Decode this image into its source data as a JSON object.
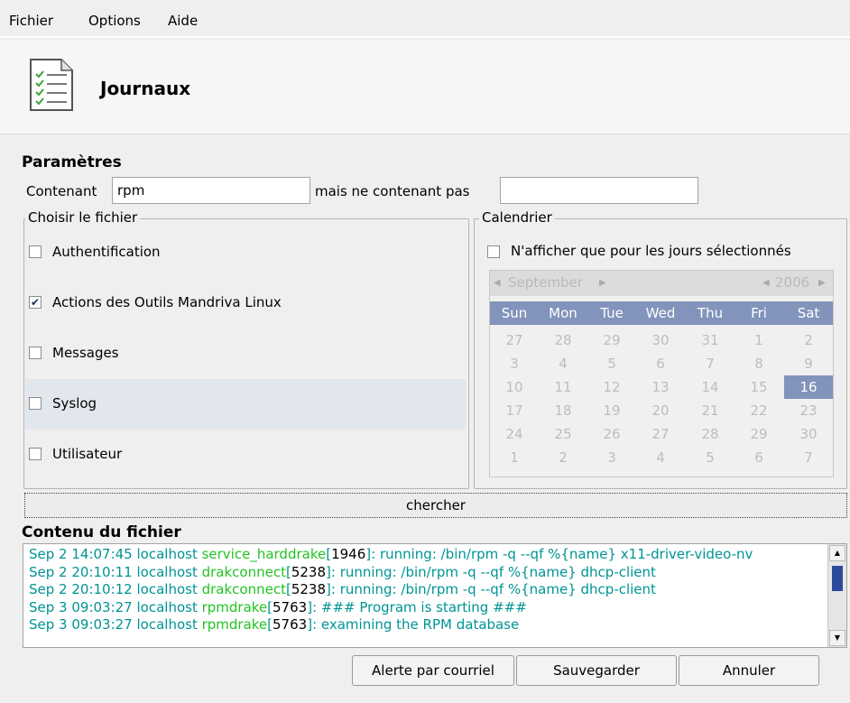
{
  "menu": [
    {
      "label": "Fichier"
    },
    {
      "label": "Options"
    },
    {
      "label": "Aide"
    }
  ],
  "banner": {
    "title": "Journaux",
    "icon": "document-checklist-icon"
  },
  "params": {
    "title": "Paramètres",
    "containing_label": "Contenant",
    "containing_value": "rpm",
    "not_containing_label": "mais ne contenant pas",
    "not_containing_value": ""
  },
  "files": {
    "title": "Choisir le fichier",
    "items": [
      {
        "label": "Authentification",
        "checked": false
      },
      {
        "label": "Actions des Outils Mandriva Linux",
        "checked": true
      },
      {
        "label": "Messages",
        "checked": false
      },
      {
        "label": "Syslog",
        "checked": false
      },
      {
        "label": "Utilisateur",
        "checked": false
      }
    ]
  },
  "calendar": {
    "title": "Calendrier",
    "only_selected_days_label": "N'afficher que pour les jours sélectionnés",
    "month": "September",
    "year": "2006",
    "weekdays": [
      "Sun",
      "Mon",
      "Tue",
      "Wed",
      "Thu",
      "Fri",
      "Sat"
    ],
    "weeks": [
      [
        "27",
        "28",
        "29",
        "30",
        "31",
        "1",
        "2"
      ],
      [
        "3",
        "4",
        "5",
        "6",
        "7",
        "8",
        "9"
      ],
      [
        "10",
        "11",
        "12",
        "13",
        "14",
        "15",
        "16"
      ],
      [
        "17",
        "18",
        "19",
        "20",
        "21",
        "22",
        "23"
      ],
      [
        "24",
        "25",
        "26",
        "27",
        "28",
        "29",
        "30"
      ],
      [
        "1",
        "2",
        "3",
        "4",
        "5",
        "6",
        "7"
      ]
    ],
    "selected_day": "16"
  },
  "search_button": "chercher",
  "content": {
    "title": "Contenu du fichier",
    "lines": [
      {
        "date": "Sep  2 14:07:45 localhost ",
        "prog": "service_harddrake",
        "pid": "1946",
        "msg": ": running: /bin/rpm -q --qf %{name} x11-driver-video-nv"
      },
      {
        "date": "Sep  2 20:10:11 localhost ",
        "prog": "drakconnect",
        "pid": "5238",
        "msg": ": running: /bin/rpm -q --qf %{name} dhcp-client"
      },
      {
        "date": "Sep  2 20:10:12 localhost ",
        "prog": "drakconnect",
        "pid": "5238",
        "msg": ": running: /bin/rpm -q --qf %{name} dhcp-client"
      },
      {
        "date": "Sep  3 09:03:27 localhost ",
        "prog": "rpmdrake",
        "pid": "5763",
        "msg": ": ### Program is starting ###"
      },
      {
        "date": "Sep  3 09:03:27 localhost ",
        "prog": "rpmdrake",
        "pid": "5763",
        "msg": ": examining the RPM database"
      }
    ]
  },
  "buttons": {
    "mail_alert": "Alerte par courriel",
    "save": "Sauvegarder",
    "cancel": "Annuler"
  },
  "colors": {
    "calendar_header": "#8294bb",
    "log_text": "#009494",
    "log_program": "#22c322",
    "selection_row": "#e2e6ed"
  }
}
